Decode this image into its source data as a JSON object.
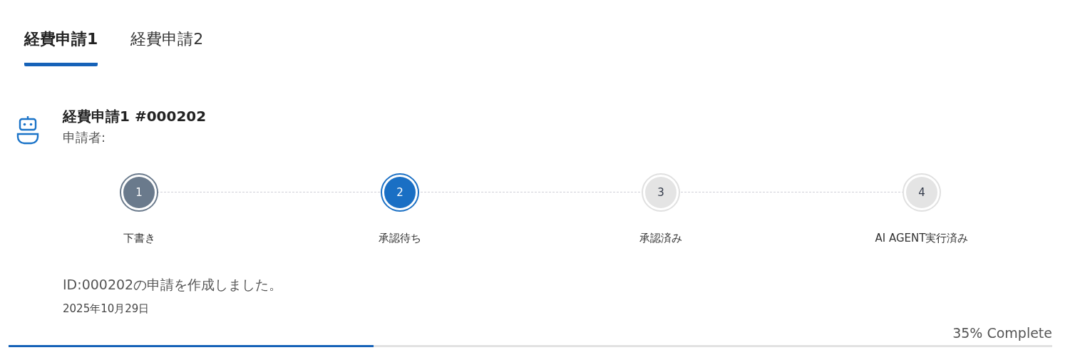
{
  "tabs": [
    {
      "label": "経費申請1",
      "selected": true
    },
    {
      "label": "経費申請2",
      "selected": false
    }
  ],
  "request": {
    "title": "経費申請1 #000202",
    "applicant_label": "申請者:"
  },
  "steps": [
    {
      "number": "1",
      "label": "下書き",
      "kind": "done"
    },
    {
      "number": "2",
      "label": "承認待ち",
      "kind": "current"
    },
    {
      "number": "3",
      "label": "承認済み",
      "kind": "pending"
    },
    {
      "number": "4",
      "label": "AI AGENT実行済み",
      "kind": "pending"
    }
  ],
  "message": "ID:000202の申請を作成しました。",
  "date": "2025年10月29日",
  "progress": {
    "reading": "35% Complete",
    "level": 0.35
  }
}
